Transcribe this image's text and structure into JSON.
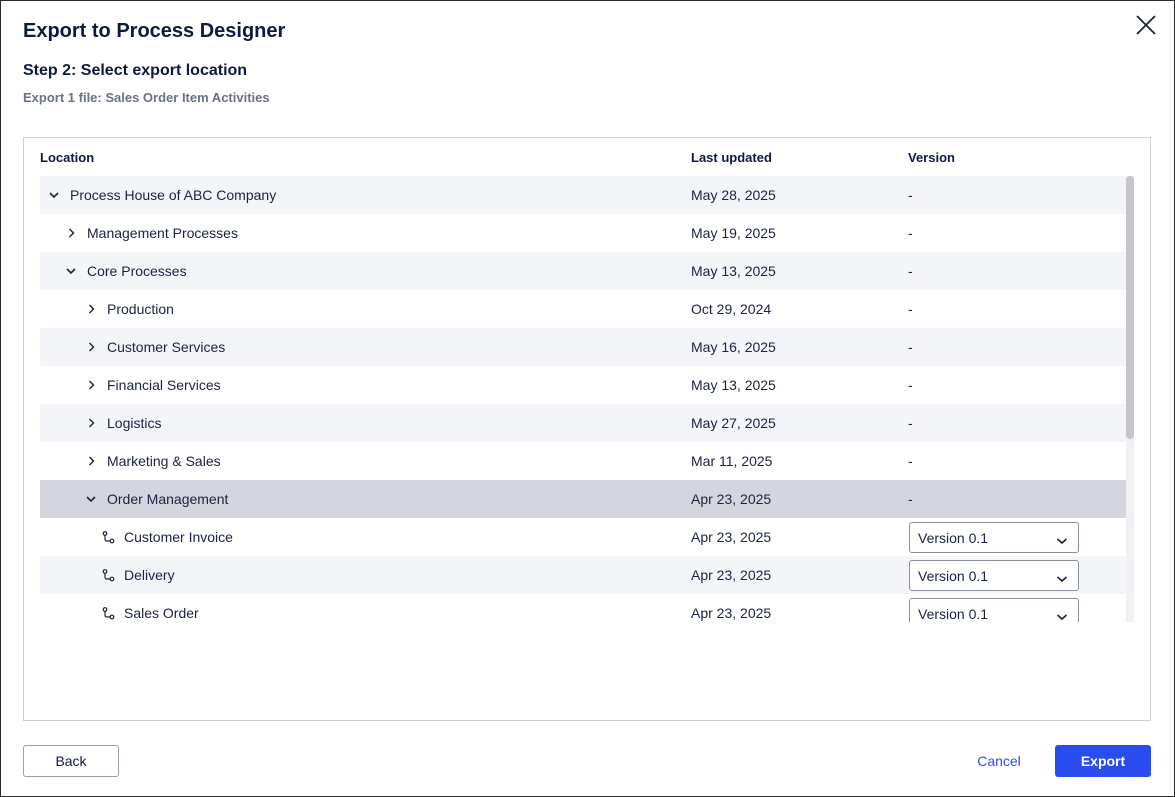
{
  "dialog": {
    "title": "Export to Process Designer",
    "step_title": "Step 2: Select export location",
    "step_subtitle": "Export 1 file: Sales Order Item Activities",
    "close_icon": "close-icon"
  },
  "table": {
    "headers": {
      "location": "Location",
      "last_updated": "Last updated",
      "version": "Version"
    },
    "rows": [
      {
        "name": "Process House of ABC Company",
        "updated": "May 28, 2025",
        "version": "-",
        "level": 0,
        "expander": "chevron-down-icon",
        "selected": false
      },
      {
        "name": "Management Processes",
        "updated": "May 19, 2025",
        "version": "-",
        "level": 1,
        "expander": "chevron-right-icon",
        "selected": false
      },
      {
        "name": "Core Processes",
        "updated": "May 13, 2025",
        "version": "-",
        "level": 1,
        "expander": "chevron-down-icon",
        "selected": false
      },
      {
        "name": "Production",
        "updated": "Oct 29, 2024",
        "version": "-",
        "level": 2,
        "expander": "chevron-right-icon",
        "selected": false
      },
      {
        "name": "Customer Services",
        "updated": "May 16, 2025",
        "version": "-",
        "level": 2,
        "expander": "chevron-right-icon",
        "selected": false
      },
      {
        "name": "Financial Services",
        "updated": "May 13, 2025",
        "version": "-",
        "level": 2,
        "expander": "chevron-right-icon",
        "selected": false
      },
      {
        "name": "Logistics",
        "updated": "May 27, 2025",
        "version": "-",
        "level": 2,
        "expander": "chevron-right-icon",
        "selected": false
      },
      {
        "name": "Marketing & Sales",
        "updated": "Mar 11, 2025",
        "version": "-",
        "level": 2,
        "expander": "chevron-right-icon",
        "selected": false
      },
      {
        "name": "Order Management",
        "updated": "Apr 23, 2025",
        "version": "-",
        "level": 2,
        "expander": "chevron-down-icon",
        "selected": true
      },
      {
        "name": "Customer Invoice",
        "updated": "Apr 23, 2025",
        "version": "Version 0.1",
        "level": 3,
        "expander": "process-icon",
        "selected": false
      },
      {
        "name": "Delivery",
        "updated": "Apr 23, 2025",
        "version": "Version 0.1",
        "level": 3,
        "expander": "process-icon",
        "selected": false
      },
      {
        "name": "Sales Order",
        "updated": "Apr 23, 2025",
        "version": "Version 0.1",
        "level": 3,
        "expander": "process-icon",
        "selected": false
      }
    ]
  },
  "footer": {
    "back_label": "Back",
    "cancel_label": "Cancel",
    "export_label": "Export"
  },
  "colors": {
    "primary": "#2a4df0",
    "selected_row": "#d4d5de",
    "alt_row": "#f4f5f8",
    "text": "#1a2340"
  }
}
